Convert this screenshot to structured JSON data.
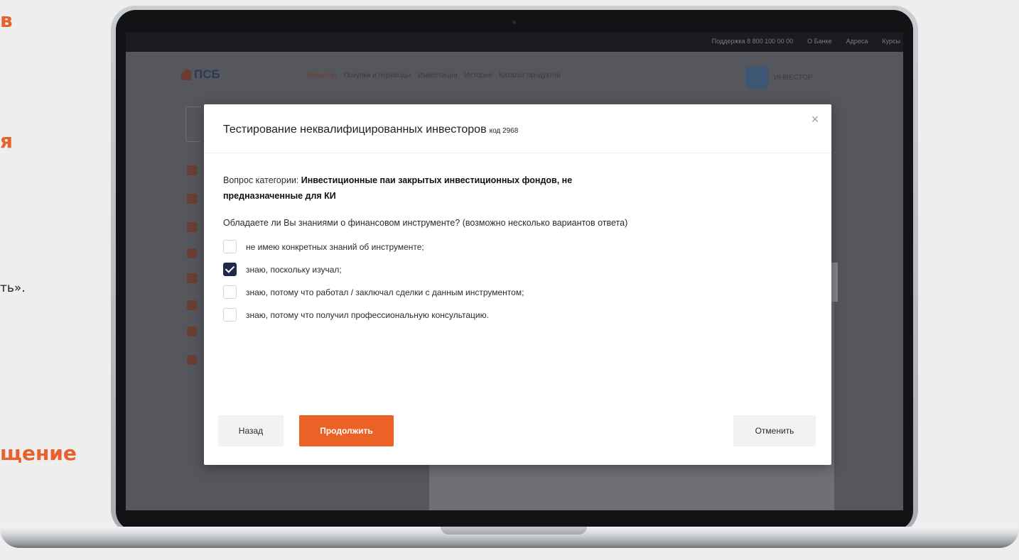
{
  "side_text": {
    "line1": "в",
    "line2": "я",
    "line3": "ть».",
    "line4": "щение"
  },
  "colors": {
    "accent": "#ec6125",
    "checkbox_checked": "#1f2a4a"
  },
  "background_site": {
    "logo_text": "ПСБ",
    "topbar_links": [
      "Поддержка 8 800 100 00 00",
      "О Банке",
      "Адреса",
      "Курсы"
    ],
    "nav": [
      "Монитор",
      "Покупки и переводы",
      "Инвестиции",
      "История",
      "Каталог продуктов"
    ],
    "user_name": "ИНВЕСТОР"
  },
  "modal": {
    "title": "Тестирование неквалифицированных инвесторов",
    "code": "код 2968",
    "close_icon": "close-icon",
    "category_prefix": "Вопрос категории: ",
    "category_bold": "Инвестиционные паи закрытых инвестиционных фондов, не предназначенные для КИ",
    "question": "Обладаете ли Вы знаниями о финансовом инструменте? (возможно несколько вариантов ответа)",
    "options": [
      {
        "label": "не имею конкретных знаний об инструменте;",
        "checked": false
      },
      {
        "label": "знаю, поскольку изучал;",
        "checked": true
      },
      {
        "label": "знаю, потому что работал / заключал сделки с данным инструментом;",
        "checked": false
      },
      {
        "label": "знаю, потому что получил профессиональную консультацию.",
        "checked": false
      }
    ],
    "buttons": {
      "back": "Назад",
      "continue": "Продолжить",
      "cancel": "Отменить"
    }
  }
}
